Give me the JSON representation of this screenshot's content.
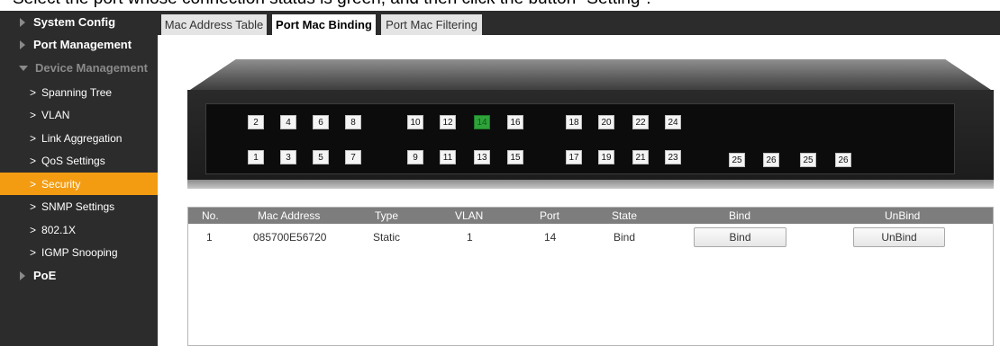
{
  "caption": "Select the port whose connection status is green, and then click the button \"Setting\".",
  "sidebar": {
    "items": [
      {
        "label": "System Config",
        "level": "top"
      },
      {
        "label": "Port Management",
        "level": "top"
      },
      {
        "label": "Device Management",
        "level": "top-open"
      },
      {
        "label": "Spanning Tree",
        "level": "sub"
      },
      {
        "label": "VLAN",
        "level": "sub"
      },
      {
        "label": "Link Aggregation",
        "level": "sub"
      },
      {
        "label": "QoS Settings",
        "level": "sub"
      },
      {
        "label": "Security",
        "level": "sub-active"
      },
      {
        "label": "SNMP Settings",
        "level": "sub"
      },
      {
        "label": "802.1X",
        "level": "sub"
      },
      {
        "label": "IGMP Snooping",
        "level": "sub"
      },
      {
        "label": "PoE",
        "level": "top"
      }
    ]
  },
  "tabs": [
    {
      "label": "Mac Address Table",
      "selected": false
    },
    {
      "label": "Port Mac Binding",
      "selected": true
    },
    {
      "label": "Port Mac Filtering",
      "selected": false
    }
  ],
  "switch": {
    "top_row": [
      "2",
      "4",
      "6",
      "8",
      "10",
      "12",
      "14",
      "16",
      "18",
      "20",
      "22",
      "24"
    ],
    "bottom_row": [
      "1",
      "3",
      "5",
      "7",
      "9",
      "11",
      "13",
      "15",
      "17",
      "19",
      "21",
      "23"
    ],
    "uplinks": [
      "25",
      "26",
      "25",
      "26"
    ],
    "active_port": "14",
    "active_color": "#2fa23a"
  },
  "table": {
    "headers": [
      "No.",
      "Mac Address",
      "Type",
      "VLAN",
      "Port",
      "State",
      "Bind",
      "UnBind"
    ],
    "rows": [
      {
        "no": "1",
        "mac": "085700E56720",
        "type": "Static",
        "vlan": "1",
        "port": "14",
        "state": "Bind",
        "bind_label": "Bind",
        "unbind_label": "UnBind"
      }
    ]
  },
  "colors": {
    "sidebar_bg": "#2c2c2c",
    "active_item": "#f39c12",
    "header_bg": "#7d7d7d"
  }
}
